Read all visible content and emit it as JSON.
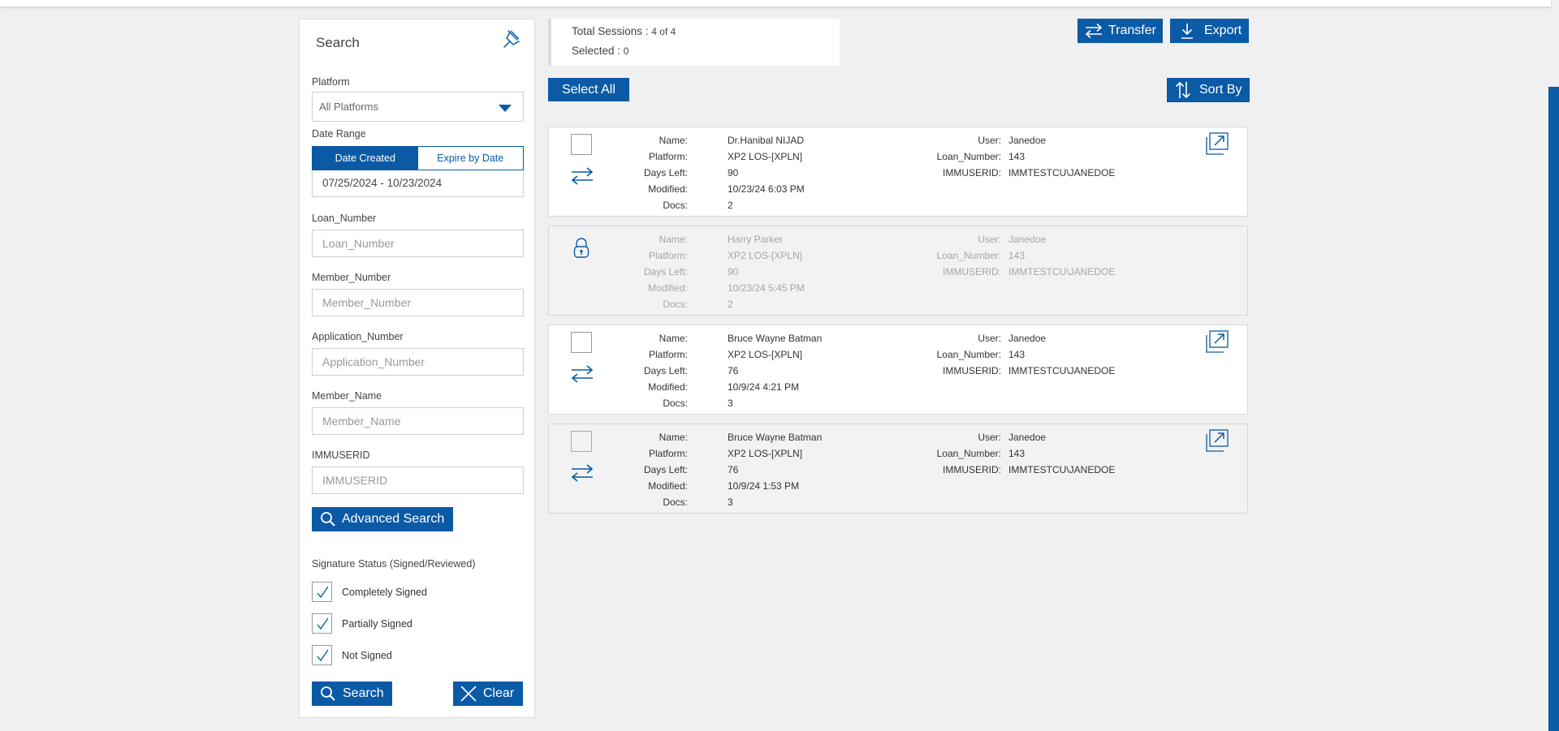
{
  "search_panel": {
    "title": "Search",
    "platform_label": "Platform",
    "platform_value": "All Platforms",
    "date_range_label": "Date Range",
    "date_tab_created": "Date Created",
    "date_tab_expire": "Expire by Date",
    "date_range_value": "07/25/2024 - 10/23/2024",
    "fields": [
      {
        "label": "Loan_Number",
        "placeholder": "Loan_Number"
      },
      {
        "label": "Member_Number",
        "placeholder": "Member_Number"
      },
      {
        "label": "Application_Number",
        "placeholder": "Application_Number"
      },
      {
        "label": "Member_Name",
        "placeholder": "Member_Name"
      },
      {
        "label": "IMMUSERID",
        "placeholder": "IMMUSERID"
      }
    ],
    "advanced_search_label": "Advanced Search",
    "signature_status_label": "Signature Status (Signed/Reviewed)",
    "signature_options": [
      {
        "label": "Completely Signed",
        "checked": true
      },
      {
        "label": "Partially Signed",
        "checked": true
      },
      {
        "label": "Not Signed",
        "checked": true
      }
    ],
    "search_button": "Search",
    "clear_button": "Clear"
  },
  "summary": {
    "total_label": "Total Sessions : ",
    "total_value": "4 of 4",
    "selected_label": "Selected : ",
    "selected_value": "0"
  },
  "toolbar": {
    "transfer": "Transfer",
    "export": "Export",
    "select_all": "Select All",
    "sort_by": "Sort By"
  },
  "field_labels": {
    "name": "Name:",
    "platform": "Platform:",
    "days_left": "Days Left:",
    "modified": "Modified:",
    "docs": "Docs:",
    "user": "User:",
    "loan_number": "Loan_Number:",
    "immuserid": "IMMUSERID:"
  },
  "sessions": [
    {
      "name": "Dr.Hanibal NIJAD",
      "platform": "XP2 LOS-[XPLN]",
      "days_left": "90",
      "modified": "10/23/24 6:03 PM",
      "docs": "2",
      "user": "Janedoe",
      "loan_number": "143",
      "immuserid": "IMMTESTCU\\JANEDOE",
      "locked": false
    },
    {
      "name": "Harry Parker",
      "platform": "XP2 LOS-[XPLN]",
      "days_left": "90",
      "modified": "10/23/24 5:45 PM",
      "docs": "2",
      "user": "Janedoe",
      "loan_number": "143",
      "immuserid": "IMMTESTCU\\JANEDOE",
      "locked": true
    },
    {
      "name": "Bruce Wayne Batman",
      "platform": "XP2 LOS-[XPLN]",
      "days_left": "76",
      "modified": "10/9/24 4:21 PM",
      "docs": "3",
      "user": "Janedoe",
      "loan_number": "143",
      "immuserid": "IMMTESTCU\\JANEDOE",
      "locked": false
    },
    {
      "name": "Bruce Wayne Batman",
      "platform": "XP2 LOS-[XPLN]",
      "days_left": "76",
      "modified": "10/9/24 1:53 PM",
      "docs": "3",
      "user": "Janedoe",
      "loan_number": "143",
      "immuserid": "IMMTESTCU\\JANEDOE",
      "locked": false
    }
  ],
  "colors": {
    "accent": "#0a5aa6",
    "background": "#f0f0f0",
    "muted_text": "#a5a5a5"
  }
}
